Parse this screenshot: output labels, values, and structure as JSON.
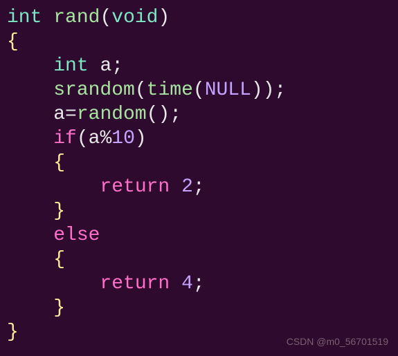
{
  "code": {
    "line1": {
      "type": "int",
      "space1": " ",
      "func": "rand",
      "lparen": "(",
      "void": "void",
      "rparen": ")"
    },
    "line2": {
      "brace": "{"
    },
    "line3": {
      "indent": "    ",
      "type": "int",
      "space": " ",
      "ident": "a",
      "semi": ";"
    },
    "line4": {
      "indent": "    ",
      "func": "srandom",
      "lparen": "(",
      "func2": "time",
      "lparen2": "(",
      "null": "NULL",
      "rparen2": ")",
      "rparen": ")",
      "semi": ";"
    },
    "line5": {
      "indent": "    ",
      "ident": "a",
      "eq": "=",
      "func": "random",
      "lparen": "(",
      "rparen": ")",
      "semi": ";"
    },
    "line6": {
      "indent": "    ",
      "if": "if",
      "lparen": "(",
      "ident": "a",
      "mod": "%",
      "num": "10",
      "rparen": ")"
    },
    "line7": {
      "indent": "    ",
      "brace": "{"
    },
    "line8": {
      "indent": "        ",
      "return": "return",
      "space": " ",
      "num": "2",
      "semi": ";"
    },
    "line9": {
      "indent": "    ",
      "brace": "}"
    },
    "line10": {
      "indent": "    ",
      "else": "else"
    },
    "line11": {
      "indent": "    ",
      "brace": "{"
    },
    "line12": {
      "indent": "        ",
      "return": "return",
      "space": " ",
      "num": "4",
      "semi": ";"
    },
    "line13": {
      "indent": "    ",
      "brace": "}"
    },
    "line14": {
      "brace": "}"
    }
  },
  "watermark": "CSDN @m0_56701519"
}
